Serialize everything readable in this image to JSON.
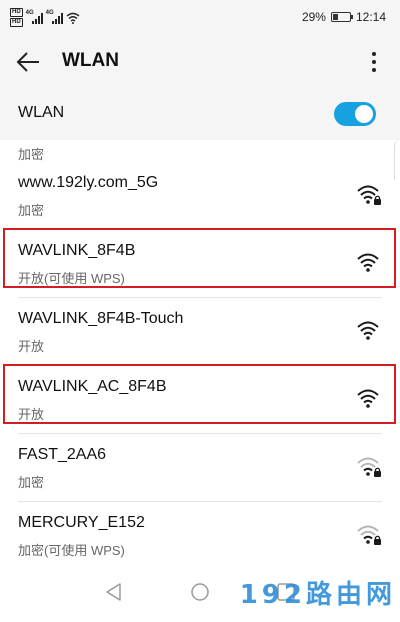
{
  "status_bar": {
    "hd_badges": [
      "HD",
      "HD"
    ],
    "network_types": [
      "4G",
      "4G"
    ],
    "battery": "29%",
    "battery_level": 0.29,
    "time": "12:14"
  },
  "header": {
    "title": "WLAN",
    "back_icon": "arrow-left-icon",
    "menu_icon": "more-vertical-icon"
  },
  "wlan_toggle": {
    "label": "WLAN",
    "state": "on",
    "accent": "#17a1e0"
  },
  "list": {
    "partial_security": "加密",
    "networks": [
      {
        "ssid": "www.192ly.com_5G",
        "security": "加密",
        "locked": true,
        "signal": 4,
        "highlighted": false
      },
      {
        "ssid": "WAVLINK_8F4B",
        "security": "开放(可使用 WPS)",
        "locked": false,
        "signal": 4,
        "highlighted": true
      },
      {
        "ssid": "WAVLINK_8F4B-Touch",
        "security": "开放",
        "locked": false,
        "signal": 4,
        "highlighted": false
      },
      {
        "ssid": "WAVLINK_AC_8F4B",
        "security": "开放",
        "locked": false,
        "signal": 4,
        "highlighted": true
      },
      {
        "ssid": "FAST_2AA6",
        "security": "加密",
        "locked": true,
        "signal": 2,
        "highlighted": false
      },
      {
        "ssid": "MERCURY_E152",
        "security": "加密(可使用 WPS)",
        "locked": true,
        "signal": 2,
        "highlighted": false
      }
    ]
  },
  "nav": {
    "back_icon": "triangle-back-icon",
    "home_icon": "circle-home-icon",
    "recents_icon": "square-recents-icon"
  },
  "watermark": "192路由网",
  "colors": {
    "highlight": "#d21d23",
    "signal_strong": "#1a1a1a",
    "signal_weak": "#b5b5b5",
    "watermark": "#2f8fd8"
  }
}
